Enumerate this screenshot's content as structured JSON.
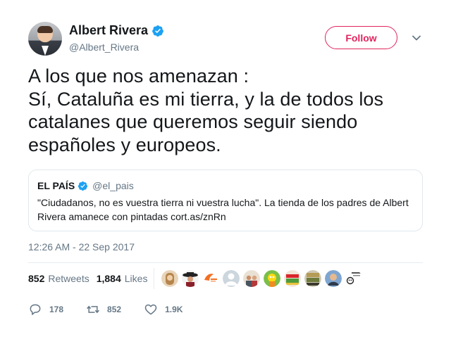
{
  "author": {
    "name": "Albert Rivera",
    "handle": "@Albert_Rivera",
    "verified": true,
    "avatar_icon": "profile-photo"
  },
  "follow_label": "Follow",
  "tweet": {
    "text": "A los que nos amenazan :\nSí, Cataluña es mi tierra, y la de todos los catalanes que queremos seguir siendo españoles y europeos."
  },
  "quoted": {
    "name": "EL PAÍS",
    "handle": "@el_pais",
    "verified": true,
    "text": "\"Ciudadanos, no es vuestra tierra ni vuestra lucha\". La tienda de los padres de Albert Rivera amanece con pintadas cort.as/znRn"
  },
  "timestamp": "12:26 AM - 22 Sep 2017",
  "stats": {
    "retweets_count": "852",
    "retweets_label": "Retweets",
    "likes_count": "1,884",
    "likes_label": "Likes"
  },
  "actions": {
    "replies": "178",
    "retweets": "852",
    "likes": "1.9K"
  },
  "colors": {
    "accent": "#e0245e",
    "verified": "#1da1f2",
    "muted": "#657786",
    "border": "#e1e8ed"
  }
}
